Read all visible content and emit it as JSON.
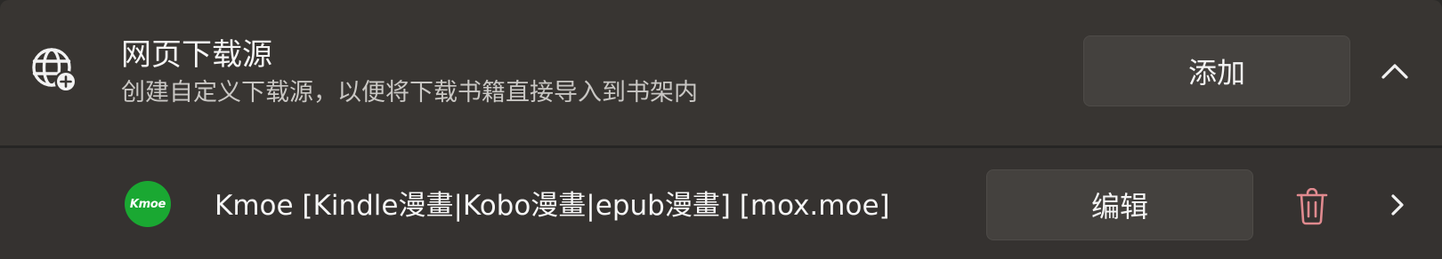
{
  "section": {
    "title": "网页下载源",
    "subtitle": "创建自定义下载源，以便将下载书籍直接导入到书架内",
    "add_label": "添加",
    "icon": "globe-add-icon",
    "collapse_icon": "chevron-up-icon"
  },
  "sources": [
    {
      "logo_text": "Kmoe",
      "logo_color": "#1aa832",
      "name": "Kmoe [Kindle漫畫|Kobo漫畫|epub漫畫] [mox.moe]",
      "edit_label": "编辑",
      "delete_icon": "trash-icon",
      "delete_icon_color": "#e08a8f",
      "open_icon": "chevron-right-icon"
    }
  ]
}
